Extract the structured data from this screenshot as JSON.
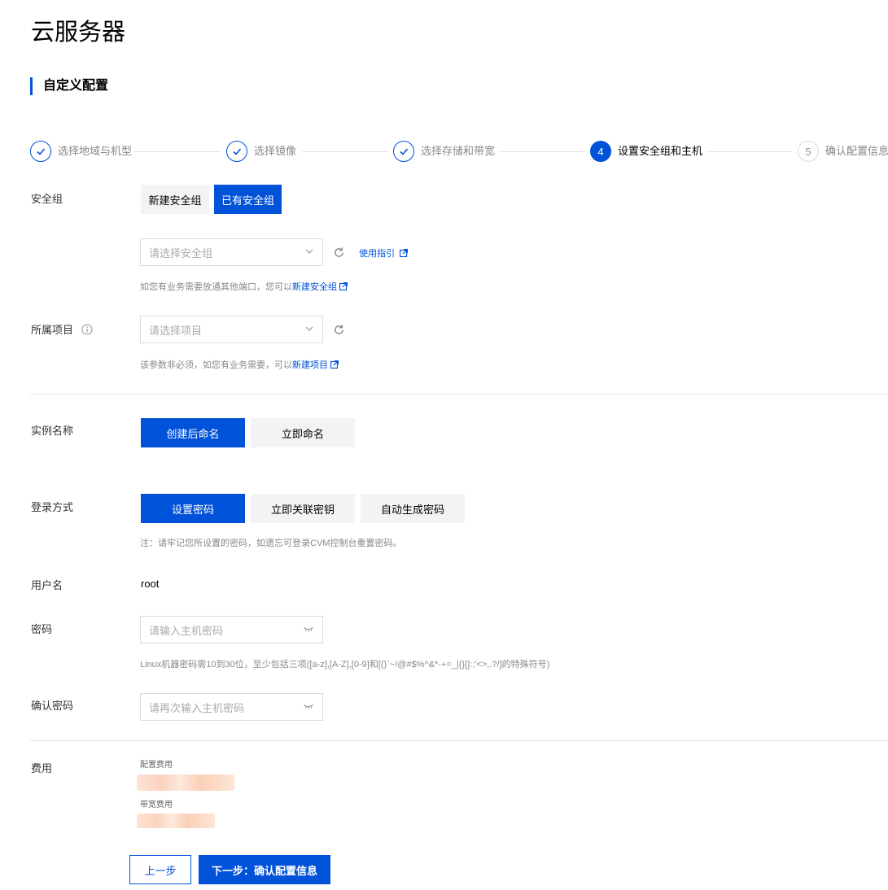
{
  "page_title": "云服务器",
  "section_title": "自定义配置",
  "steps": [
    {
      "label": "选择地域与机型",
      "state": "done"
    },
    {
      "label": "选择镜像",
      "state": "done"
    },
    {
      "label": "选择存储和带宽",
      "state": "done"
    },
    {
      "number": "4",
      "label": "设置安全组和主机",
      "state": "active"
    },
    {
      "number": "5",
      "label": "确认配置信息",
      "state": "todo"
    }
  ],
  "security_group": {
    "label": "安全组",
    "tabs": [
      {
        "label": "新建安全组",
        "selected": false
      },
      {
        "label": "已有安全组",
        "selected": true
      }
    ],
    "select_placeholder": "请选择安全组",
    "guide_link": "使用指引",
    "hint_prefix": "如您有业务需要放通其他端口，您可以",
    "hint_link": "新建安全组"
  },
  "project": {
    "label": "所属项目",
    "select_placeholder": "请选择项目",
    "hint_prefix": "该参数非必须，如您有业务需要，可以",
    "hint_link": "新建项目"
  },
  "instance_name": {
    "label": "实例名称",
    "options": [
      {
        "label": "创建后命名",
        "selected": true
      },
      {
        "label": "立即命名",
        "selected": false
      }
    ]
  },
  "login_method": {
    "label": "登录方式",
    "options": [
      {
        "label": "设置密码",
        "selected": true
      },
      {
        "label": "立即关联密钥",
        "selected": false
      },
      {
        "label": "自动生成密码",
        "selected": false
      }
    ],
    "note": "注：请牢记您所设置的密码，如遗忘可登录CVM控制台重置密码。"
  },
  "username": {
    "label": "用户名",
    "value": "root"
  },
  "password": {
    "label": "密码",
    "placeholder": "请输入主机密码",
    "hint": "Linux机器密码需10到30位，至少包括三项([a-z],[A-Z],[0-9]和[()`~!@#$%^&*-+=_|{}[]:;'<>,.?/]的特殊符号)"
  },
  "confirm_password": {
    "label": "确认密码",
    "placeholder": "请再次输入主机密码"
  },
  "fees": {
    "label": "费用",
    "config_fee_label": "配置费用",
    "bandwidth_fee_label": "带宽费用"
  },
  "footer": {
    "prev_label": "上一步",
    "next_label": "下一步：确认配置信息"
  },
  "colors": {
    "accent": "#0052d9",
    "inactive_button": "#f2f3f5"
  }
}
